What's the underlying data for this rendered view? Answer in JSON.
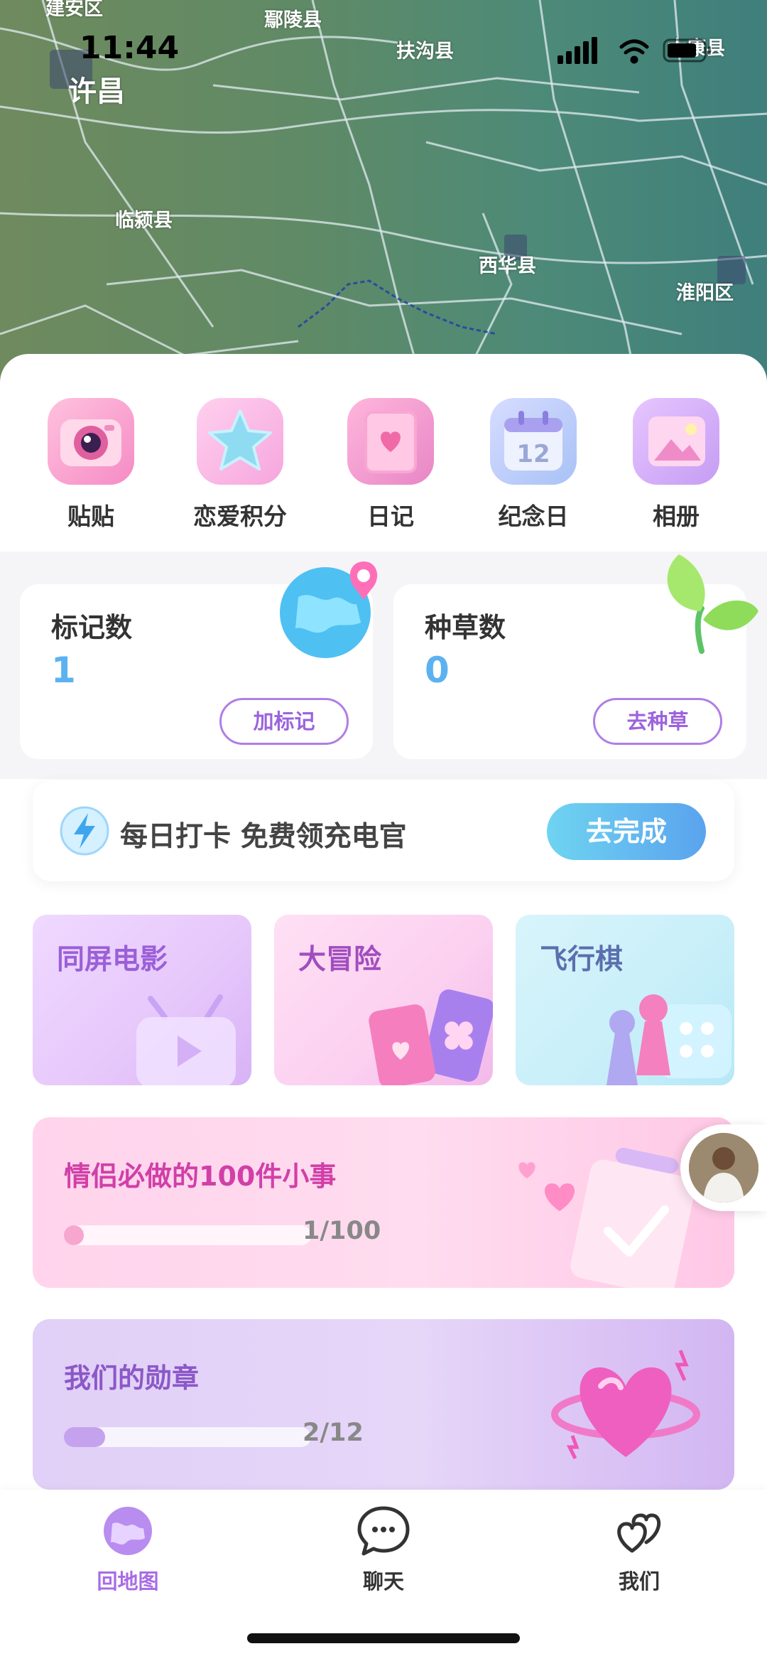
{
  "status_bar": {
    "time": "11:44"
  },
  "map": {
    "places": [
      "建安区",
      "鄢陵县",
      "扶沟县",
      "许昌",
      "临颍县",
      "西华县",
      "淮阳区",
      "太康县"
    ]
  },
  "quick_actions": [
    {
      "label": "贴贴",
      "icon": "camera-icon"
    },
    {
      "label": "恋爱积分",
      "icon": "star-icon"
    },
    {
      "label": "日记",
      "icon": "diary-icon"
    },
    {
      "label": "纪念日",
      "icon": "calendar-icon"
    },
    {
      "label": "相册",
      "icon": "photo-album-icon"
    }
  ],
  "stats": {
    "marks": {
      "title": "标记数",
      "value": "1",
      "button": "加标记"
    },
    "plants": {
      "title": "种草数",
      "value": "0",
      "button": "去种草"
    }
  },
  "checkin": {
    "text": "每日打卡 免费领充电官",
    "button": "去完成"
  },
  "games": [
    {
      "title": "同屏电影"
    },
    {
      "title": "大冒险"
    },
    {
      "title": "飞行棋"
    }
  ],
  "progress_cards": {
    "things": {
      "title": "情侣必做的100件小事",
      "count": "1/100",
      "progress": 0.01
    },
    "badges": {
      "title": "我们的勋章",
      "count": "2/12",
      "progress": 0.1667
    }
  },
  "tabs": [
    {
      "label": "回地图",
      "icon": "globe-icon",
      "active": true
    },
    {
      "label": "聊天",
      "icon": "chat-icon",
      "active": false
    },
    {
      "label": "我们",
      "icon": "hearts-icon",
      "active": false
    }
  ],
  "colors": {
    "accent_purple": "#a86ce6",
    "stat_value_blue": "#5cb2f0",
    "checkin_button": "#5aa3ee",
    "things_title": "#d13fa8",
    "badges_title": "#8b58c8"
  }
}
